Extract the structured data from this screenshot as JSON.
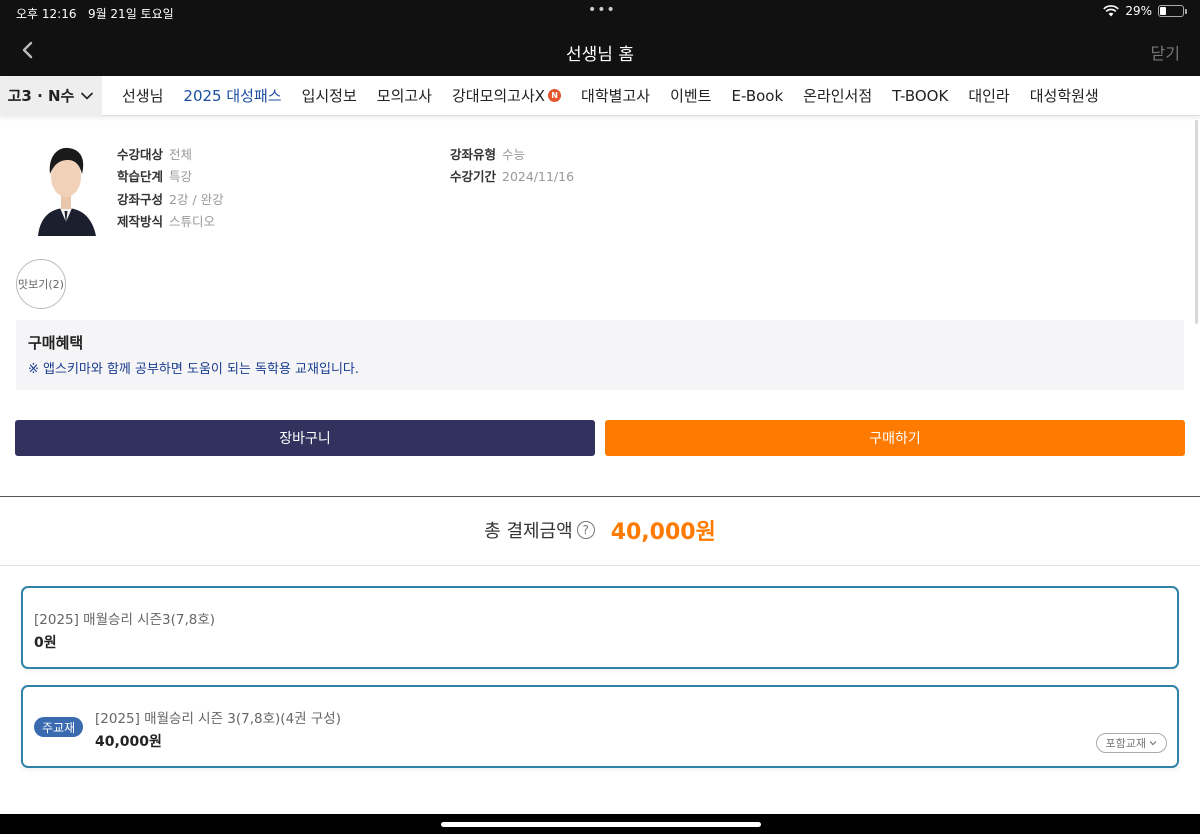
{
  "status": {
    "time": "오후 12:16",
    "date": "9월 21일 토요일",
    "battery": "29%",
    "battery_level": 0.29
  },
  "titlebar": {
    "title": "선생님 홈",
    "close": "닫기"
  },
  "nav": {
    "grade": "고3 · N수",
    "items": [
      "선생님",
      "2025 대성패스",
      "입시정보",
      "모의고사",
      "강대모의고사X",
      "대학별고사",
      "이벤트",
      "E-Book",
      "온라인서점",
      "T-BOOK",
      "대인라",
      "대성학원생"
    ],
    "new_badge": "N"
  },
  "course": {
    "target_k": "수강대상",
    "target_v": "전체",
    "stage_k": "학습단계",
    "stage_v": "특강",
    "composition_k": "강좌구성",
    "composition_v": "2강 / 완강",
    "production_k": "제작방식",
    "production_v": "스튜디오",
    "type_k": "강좌유형",
    "type_v": "수능",
    "period_k": "수강기간",
    "period_v": "2024/11/16"
  },
  "preview": "맛보기(2)",
  "benefit": {
    "title": "구매혜택",
    "desc": "※ 앱스키마와 함께 공부하면 도움이 되는 독학용 교재입니다."
  },
  "buttons": {
    "cart": "장바구니",
    "buy": "구매하기"
  },
  "total": {
    "label": "총 결제금액",
    "help": "?",
    "amount": "40,000원"
  },
  "items": [
    {
      "name": "[2025] 매월승리 시즌3(7,8호)",
      "price": "0원"
    },
    {
      "tag": "주교재",
      "name": "[2025] 매월승리 시즌 3(7,8호)(4권 구성)",
      "price": "40,000원",
      "include": "포함교재"
    }
  ],
  "colors": {
    "accent_orange": "#ff7a00",
    "cart_navy": "#32325e",
    "nav_active": "#1c4ea0",
    "card_border": "#2f82a8"
  }
}
